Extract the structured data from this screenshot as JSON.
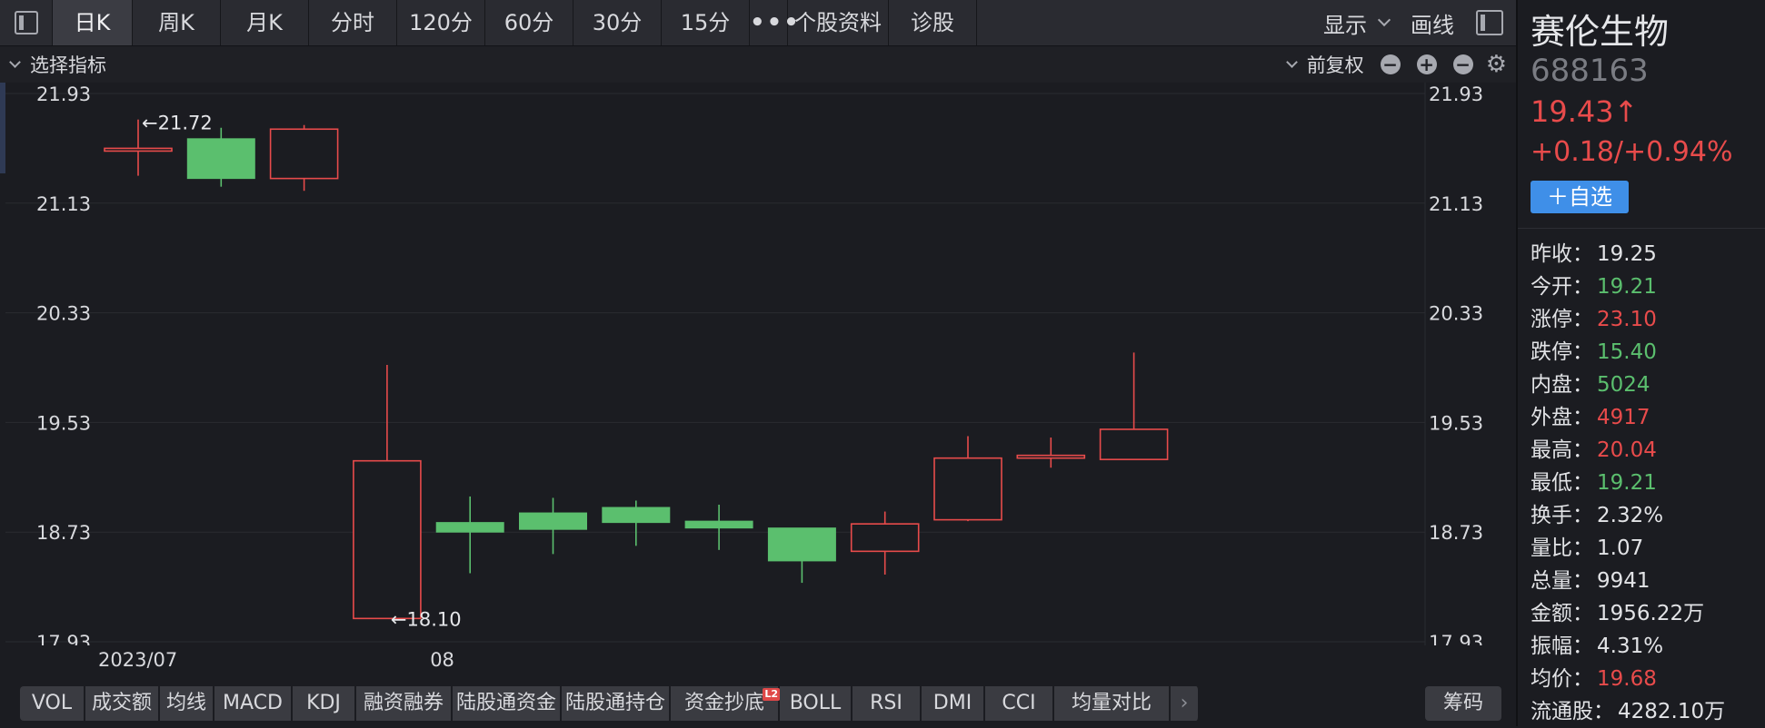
{
  "top_tabs": [
    "日K",
    "周K",
    "月K",
    "分时",
    "120分",
    "60分",
    "30分",
    "15分",
    "•••",
    "个股资料",
    "诊股"
  ],
  "top_tab_active": 0,
  "toolbar": {
    "display_label": "显示",
    "draw_label": "画线"
  },
  "subbar": {
    "indicator_select_label": "选择指标",
    "adjust_label": "前复权",
    "minus_label": "−",
    "plus_label": "+"
  },
  "chart_data": {
    "type": "candlestick",
    "y_ticks": [
      "21.93",
      "21.13",
      "20.33",
      "19.53",
      "18.73",
      "17.93"
    ],
    "ylim": [
      17.93,
      21.93
    ],
    "x_labels": [
      {
        "label": "2023/07",
        "index": 0
      },
      {
        "label": "08",
        "index": 4
      }
    ],
    "annotations": [
      {
        "text": "←21.72",
        "value": 21.72,
        "index": 0
      },
      {
        "text": "←18.10",
        "value": 18.1,
        "index": 3
      }
    ],
    "candles": [
      {
        "open": 21.51,
        "close": 21.53,
        "high": 21.74,
        "low": 21.33,
        "up": true
      },
      {
        "open": 21.6,
        "close": 21.31,
        "high": 21.68,
        "low": 21.25,
        "up": false
      },
      {
        "open": 21.31,
        "close": 21.67,
        "high": 21.7,
        "low": 21.22,
        "up": true
      },
      {
        "open": 18.1,
        "close": 19.25,
        "high": 19.95,
        "low": 18.1,
        "up": true
      },
      {
        "open": 18.73,
        "close": 18.8,
        "high": 18.99,
        "low": 18.43,
        "up": false
      },
      {
        "open": 18.75,
        "close": 18.87,
        "high": 18.98,
        "low": 18.57,
        "up": false
      },
      {
        "open": 18.8,
        "close": 18.91,
        "high": 18.96,
        "low": 18.63,
        "up": false
      },
      {
        "open": 18.76,
        "close": 18.81,
        "high": 18.93,
        "low": 18.6,
        "up": false
      },
      {
        "open": 18.52,
        "close": 18.76,
        "high": 18.76,
        "low": 18.36,
        "up": false
      },
      {
        "open": 18.59,
        "close": 18.79,
        "high": 18.88,
        "low": 18.42,
        "up": true
      },
      {
        "open": 18.82,
        "close": 19.27,
        "high": 19.43,
        "low": 18.81,
        "up": true
      },
      {
        "open": 19.27,
        "close": 19.29,
        "high": 19.42,
        "low": 19.2,
        "up": true
      },
      {
        "open": 19.26,
        "close": 19.48,
        "high": 20.04,
        "low": 19.26,
        "up": true
      }
    ],
    "colors": {
      "up": "#e84b4b",
      "down": "#5bbf6e",
      "grid": "#2a2b31",
      "text": "#d8d9dd"
    }
  },
  "indicators": [
    "VOL",
    "成交额",
    "均线",
    "MACD",
    "KDJ",
    "融资融券",
    "陆股通资金",
    "陆股通持仓",
    "资金抄底",
    "BOLL",
    "RSI",
    "DMI",
    "CCI",
    "均量对比"
  ],
  "indicator_badge": {
    "index": 8,
    "text": "L2"
  },
  "indicator_next": "›",
  "chouma_label": "筹码",
  "stock": {
    "name": "赛伦生物",
    "code": "688163",
    "price": "19.43↑",
    "change": "+0.18/+0.94%",
    "add_label": "＋自选"
  },
  "quotes": [
    {
      "label": "昨收：",
      "value": "19.25",
      "color": "white"
    },
    {
      "label": "今开：",
      "value": "19.21",
      "color": "green"
    },
    {
      "label": "涨停：",
      "value": "23.10",
      "color": "red"
    },
    {
      "label": "跌停：",
      "value": "15.40",
      "color": "green"
    },
    {
      "label": "内盘：",
      "value": "5024",
      "color": "green"
    },
    {
      "label": "外盘：",
      "value": "4917",
      "color": "red"
    },
    {
      "label": "最高：",
      "value": "20.04",
      "color": "red"
    },
    {
      "label": "最低：",
      "value": "19.21",
      "color": "green"
    },
    {
      "label": "换手：",
      "value": "2.32%",
      "color": "white"
    },
    {
      "label": "量比：",
      "value": "1.07",
      "color": "white"
    },
    {
      "label": "总量：",
      "value": "9941",
      "color": "white"
    },
    {
      "label": "金额：",
      "value": "1956.22万",
      "color": "white"
    },
    {
      "label": "振幅：",
      "value": "4.31%",
      "color": "white"
    },
    {
      "label": "均价：",
      "value": "19.68",
      "color": "red"
    },
    {
      "label": "流通股：",
      "value": "4282.10万",
      "color": "white"
    }
  ]
}
